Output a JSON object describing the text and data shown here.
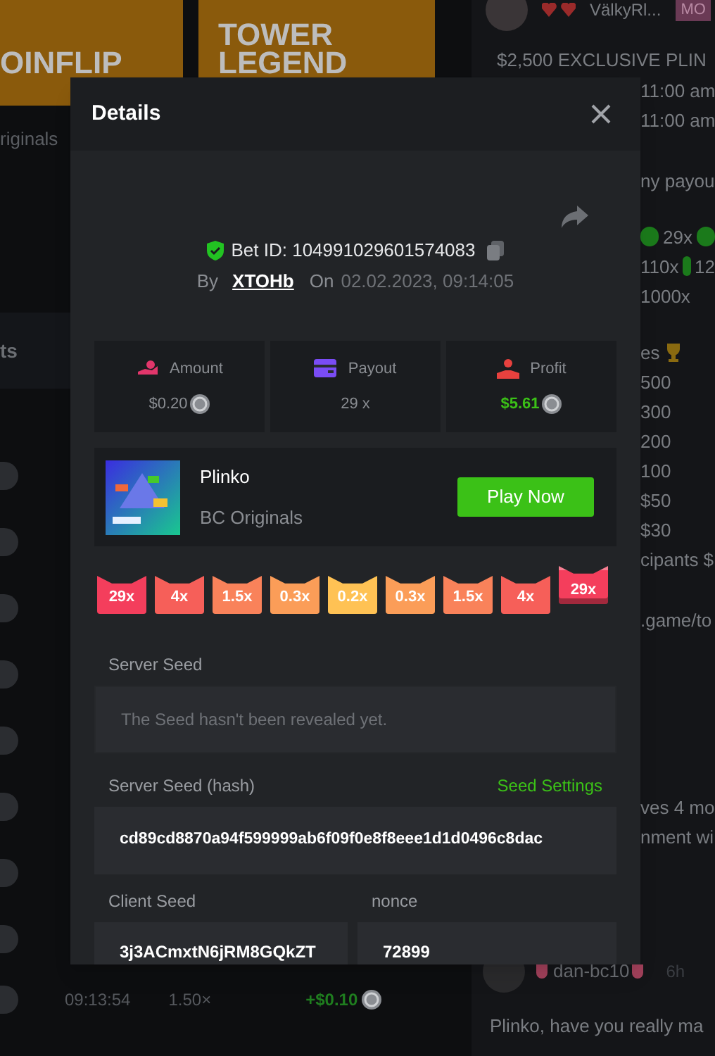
{
  "background": {
    "tiles": [
      {
        "title": "OINFLIP"
      },
      {
        "title": "TOWER LEGEND"
      }
    ],
    "tile_caption": "riginals",
    "section_label": "ts",
    "rows": [
      {
        "kind": "coin"
      },
      {
        "kind": "coin"
      },
      {
        "kind": "coin"
      },
      {
        "kind": "coin"
      },
      {
        "kind": "coin"
      },
      {
        "kind": "coin"
      },
      {
        "kind": "coin"
      },
      {
        "kind": "coin"
      }
    ],
    "last_row": {
      "time": "09:13:54",
      "payout": "1.50×",
      "profit": "+$0.10"
    }
  },
  "chat": {
    "top_user": {
      "name": "VälkyRl...",
      "badge": "MO"
    },
    "headline": "$2,500 EXCLUSIVE PLIN",
    "lines": [
      {
        "text": "11:00 am"
      },
      {
        "text": "11:00 am"
      },
      {
        "text": "ny payou"
      },
      {
        "text": "29x",
        "dot_before": true,
        "dot_after": true
      },
      {
        "text": "110x",
        "dot_after": true,
        "after": "12"
      },
      {
        "text": "1000x"
      },
      {
        "text": "es",
        "trophy": true
      },
      {
        "text": "500"
      },
      {
        "text": "300"
      },
      {
        "text": "200"
      },
      {
        "text": "100"
      },
      {
        "text": "$50"
      },
      {
        "text": "$30"
      },
      {
        "text": "cipants $"
      },
      {
        "text": ".game/to"
      },
      {
        "text": "ves 4 mo"
      },
      {
        "text": "nment wi"
      }
    ],
    "bottom_user": {
      "name": "dan-bc10",
      "time": "6h"
    },
    "bottom_message": "Plinko, have you really ma"
  },
  "modal": {
    "title": "Details",
    "bet_id": "Bet ID: 104991029601574083",
    "by_label": "By",
    "user": "XTOHb",
    "on_label": "On",
    "date": "02.02.2023, 09:14:05",
    "stats": [
      {
        "kind": "amount",
        "label": "Amount",
        "value": "$0.20",
        "coin": true
      },
      {
        "kind": "payout",
        "label": "Payout",
        "value": "29 x",
        "coin": false
      },
      {
        "kind": "profit",
        "label": "Profit",
        "value": "$5.61",
        "coin": true
      }
    ],
    "game": {
      "name": "Plinko",
      "provider": "BC Originals",
      "button": "Play Now"
    },
    "multipliers": [
      {
        "label": "29x",
        "color": "#f43e5c",
        "selected": false
      },
      {
        "label": "4x",
        "color": "#f65f59",
        "selected": false
      },
      {
        "label": "1.5x",
        "color": "#f9825a",
        "selected": false
      },
      {
        "label": "0.3x",
        "color": "#fb9d58",
        "selected": false
      },
      {
        "label": "0.2x",
        "color": "#ffc254",
        "selected": false
      },
      {
        "label": "0.3x",
        "color": "#fb9d58",
        "selected": false
      },
      {
        "label": "1.5x",
        "color": "#f9825a",
        "selected": false
      },
      {
        "label": "4x",
        "color": "#f65f59",
        "selected": false
      },
      {
        "label": "29x",
        "color": "#f43e5c",
        "selected": true
      }
    ],
    "server_seed": {
      "label": "Server Seed",
      "value": "The Seed hasn't been revealed yet."
    },
    "server_seed_hash": {
      "label": "Server Seed (hash)",
      "link": "Seed Settings",
      "value": "cd89cd8870a94f599999ab6f09f0e8f8eee1d1d0496c8dac"
    },
    "client_seed": {
      "label": "Client Seed",
      "value": "3j3ACmxtN6jRM8GQkZT"
    },
    "nonce": {
      "label": "nonce",
      "value": "72899"
    }
  }
}
